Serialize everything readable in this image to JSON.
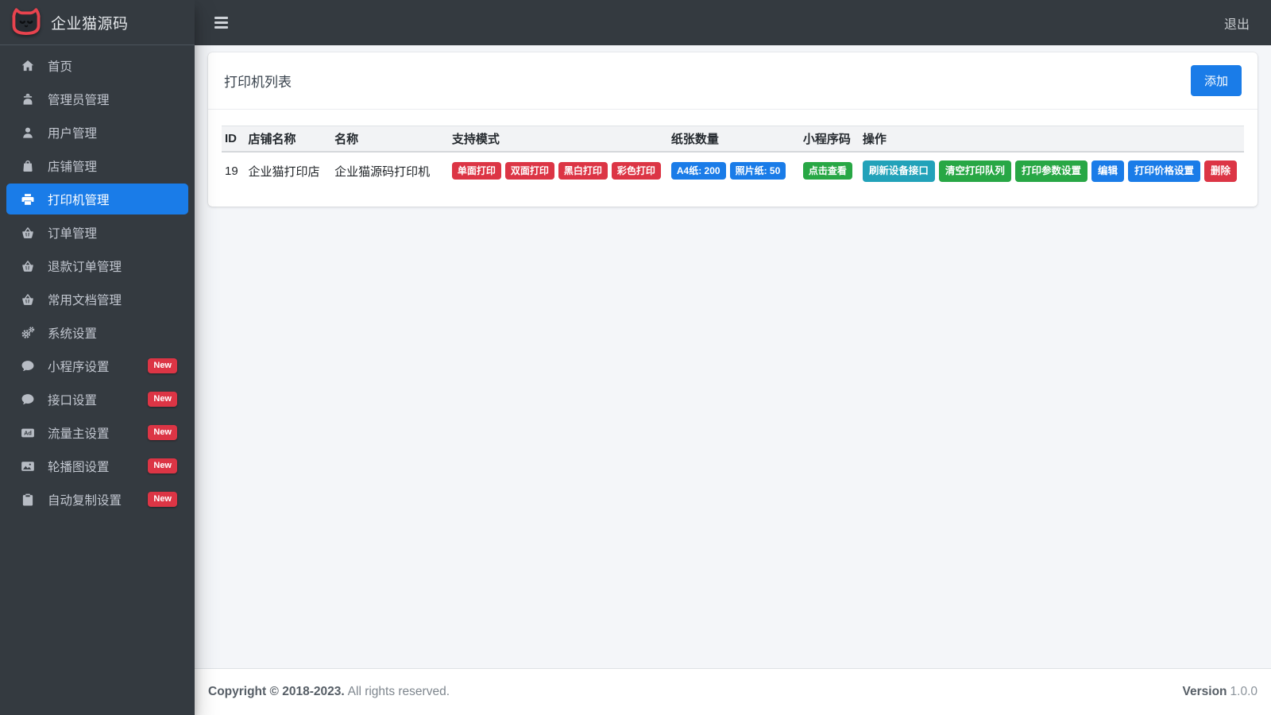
{
  "brand": {
    "title": "企业猫源码",
    "logo_icon": "cat-logo-icon"
  },
  "navbar": {
    "logout_label": "退出",
    "menu_toggle_icon": "hamburger-icon"
  },
  "sidebar": {
    "new_badge_label": "New",
    "items": [
      {
        "key": "home",
        "label": "首页",
        "icon": "home-icon",
        "active": false,
        "new": false
      },
      {
        "key": "admin-manage",
        "label": "管理员管理",
        "icon": "admin-icon",
        "active": false,
        "new": false
      },
      {
        "key": "user-manage",
        "label": "用户管理",
        "icon": "user-icon",
        "active": false,
        "new": false
      },
      {
        "key": "shop-manage",
        "label": "店铺管理",
        "icon": "shop-bag-icon",
        "active": false,
        "new": false
      },
      {
        "key": "printer-manage",
        "label": "打印机管理",
        "icon": "printer-icon",
        "active": true,
        "new": false
      },
      {
        "key": "order-manage",
        "label": "订单管理",
        "icon": "basket-icon",
        "active": false,
        "new": false
      },
      {
        "key": "refund-order-manage",
        "label": "退款订单管理",
        "icon": "basket-icon",
        "active": false,
        "new": false
      },
      {
        "key": "common-doc-manage",
        "label": "常用文档管理",
        "icon": "basket-icon",
        "active": false,
        "new": false
      },
      {
        "key": "system-settings",
        "label": "系统设置",
        "icon": "cogs-icon",
        "active": false,
        "new": false
      },
      {
        "key": "miniprogram-settings",
        "label": "小程序设置",
        "icon": "comment-icon",
        "active": false,
        "new": true
      },
      {
        "key": "api-settings",
        "label": "接口设置",
        "icon": "comment-icon",
        "active": false,
        "new": true
      },
      {
        "key": "ad-settings",
        "label": "流量主设置",
        "icon": "ad-icon",
        "active": false,
        "new": true
      },
      {
        "key": "carousel-settings",
        "label": "轮播图设置",
        "icon": "image-icon",
        "active": false,
        "new": true
      },
      {
        "key": "auto-copy-settings",
        "label": "自动复制设置",
        "icon": "clipboard-icon",
        "active": false,
        "new": true
      }
    ]
  },
  "card": {
    "title": "打印机列表",
    "add_button_label": "添加"
  },
  "table": {
    "headers": [
      "ID",
      "店铺名称",
      "名称",
      "支持模式",
      "纸张数量",
      "小程序码",
      "操作"
    ],
    "rows": [
      {
        "id": "19",
        "shop_name": "企业猫打印店",
        "name": "企业猫源码打印机",
        "modes": [
          "单面打印",
          "双面打印",
          "黑白打印",
          "彩色打印"
        ],
        "paper": [
          "A4纸: 200",
          "照片纸: 50"
        ],
        "qrcode_label": "点击查看",
        "actions": [
          {
            "key": "refresh-device",
            "label": "刷新设备接口",
            "type": "info"
          },
          {
            "key": "clear-queue",
            "label": "清空打印队列",
            "type": "success"
          },
          {
            "key": "print-params",
            "label": "打印参数设置",
            "type": "success"
          },
          {
            "key": "edit",
            "label": "编辑",
            "type": "primary"
          },
          {
            "key": "price-settings",
            "label": "打印价格设置",
            "type": "primary"
          },
          {
            "key": "delete",
            "label": "删除",
            "type": "danger"
          }
        ]
      }
    ]
  },
  "footer": {
    "copyright_bold": "Copyright © 2018-2023.",
    "copyright_rest": "All rights reserved.",
    "version_label": "Version",
    "version_value": "1.0.0"
  },
  "colors": {
    "primary": "#1a7ce8",
    "success": "#28a745",
    "info": "#22a2b9",
    "danger": "#dc3545",
    "sidebar_bg": "#343a40",
    "content_bg": "#f4f6f9"
  }
}
